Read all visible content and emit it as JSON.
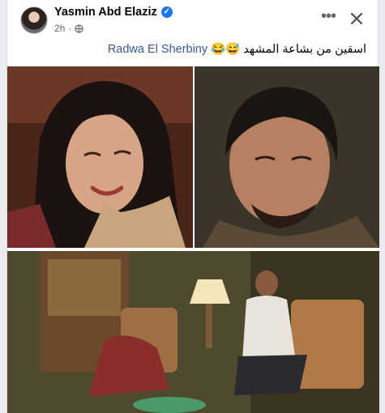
{
  "post": {
    "author": "Yasmin Abd Elaziz",
    "verified_mark": "✓",
    "time": "2h",
    "privacy_icon": "globe-icon",
    "caption_text": "اسقين من بشاعة المشهد 😅😂 ",
    "mention": "Radwa El Sherbiny"
  },
  "header": {
    "more_icon": "more-dots-icon",
    "more_glyph": "•••",
    "close_icon": "close-icon"
  },
  "colors": {
    "link": "#385898",
    "meta": "#65676b",
    "verified": "#1877f2"
  }
}
